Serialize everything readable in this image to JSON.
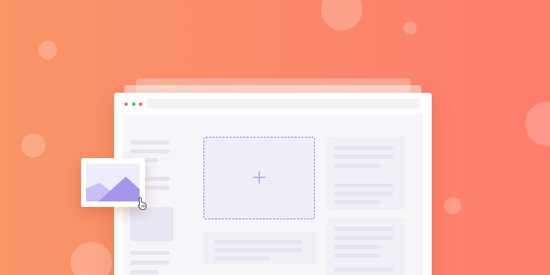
{
  "illustration": {
    "accent_color": "#7f6fe0",
    "background_gradient": [
      "#f99567",
      "#fe7d6b"
    ],
    "window_dots": [
      "#ff6a5e",
      "#2fd156",
      "#ff5f57"
    ],
    "drop_zone": {
      "icon": "plus-icon"
    },
    "dragged_item": {
      "icon": "image-icon"
    },
    "pointer": {
      "icon": "hand-pointer-icon"
    }
  }
}
